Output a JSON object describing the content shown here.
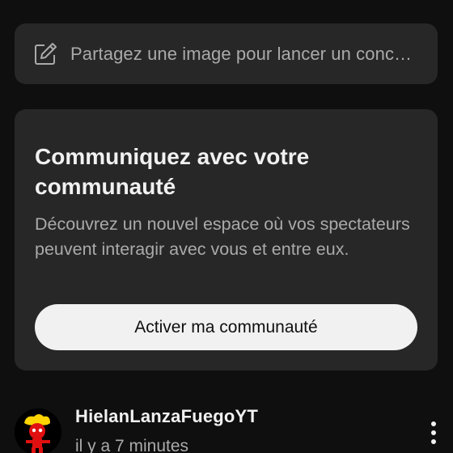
{
  "composer": {
    "placeholder": "Partagez une image pour lancer un conc…",
    "icon": "edit-icon"
  },
  "community_card": {
    "title": "Communiquez avec votre communauté",
    "description": "Découvrez un nouvel espace où vos spectateurs peuvent interagir avec vous et entre eux.",
    "button_label": "Activer ma communauté"
  },
  "post": {
    "author": "HielanLanzaFuegoYT",
    "timestamp": "il y a 7 minutes",
    "avatar_icon": "red-character-avatar",
    "menu_icon": "more-vertical-icon"
  },
  "colors": {
    "background": "#0f0f0f",
    "card": "#272727",
    "primary_text": "#f1f1f1",
    "secondary_text": "#aaaaaa",
    "button_bg": "#f1f1f1"
  }
}
